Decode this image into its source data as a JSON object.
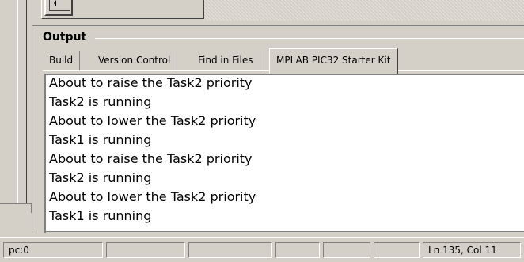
{
  "output": {
    "title": "Output",
    "tabs": [
      {
        "label": "Build",
        "active": false
      },
      {
        "label": "Version Control",
        "active": false
      },
      {
        "label": "Find in Files",
        "active": false
      },
      {
        "label": "MPLAB PIC32 Starter Kit",
        "active": true
      }
    ],
    "lines": [
      "About to raise the Task2 priority",
      "Task2 is running",
      "About to lower the Task2 priority",
      "Task1 is running",
      "About to raise the Task2 priority",
      "Task2 is running",
      "About to lower the Task2 priority",
      "Task1 is running"
    ]
  },
  "statusbar": {
    "pc": "pc:0",
    "position": "Ln 135, Col 11"
  },
  "icons": {
    "scroll_left": "scroll-left-arrow-icon"
  }
}
